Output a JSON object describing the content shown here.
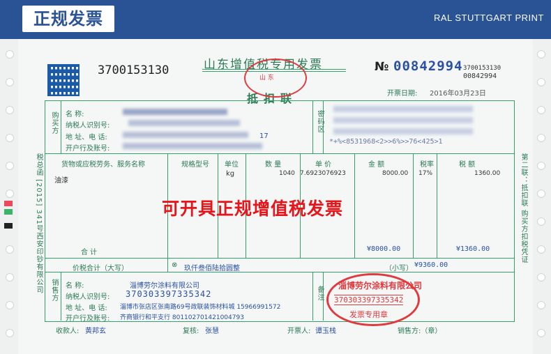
{
  "header": {
    "title": "正规发票",
    "brand": "RAL STUTTGART PRINT"
  },
  "invoice": {
    "code": "3700153130",
    "title": "山东增值税专用发票",
    "copy_label": "抵扣联",
    "number_symbol": "№",
    "number": "00842994",
    "code_small": "3700153130",
    "number_small": "00842994",
    "issue_date_label": "开票日期:",
    "issue_date": "2016年03月23日",
    "side_left": "税总函 [2015] 341号西安印钞有限公司",
    "side_right": "第二联：抵扣联 购买方扣税凭证",
    "buyer": {
      "section": "购买方",
      "name_label": "名      称:",
      "tax_id_label": "纳税人识别号:",
      "address_label": "地 址、电 话:",
      "bank_label": "开户行及账号:",
      "address_tail": "17"
    },
    "cipher": {
      "section": "密码区",
      "line4": "*+%<8531968<2>>6%>>76<425>1"
    },
    "columns": {
      "goods": "货物或应税劳务、服务名称",
      "spec": "规格型号",
      "unit": "单位",
      "qty": "数 量",
      "price": "单 价",
      "amount": "金     额",
      "rate": "税率",
      "tax": "税     额"
    },
    "item": {
      "name": "油漆",
      "unit": "kg",
      "qty": "1040",
      "price": "7.6923076923",
      "amount": "8000.00",
      "rate": "17%",
      "tax": "1360.00"
    },
    "total_label": "合          计",
    "total_amount": "¥8000.00",
    "total_tax": "¥1360.00",
    "grand_label": "价税合计（大写）",
    "grand_words_icon": "⊗",
    "grand_words": "玖仟叁佰陆拾圆整",
    "grand_small_label": "（小写）",
    "grand_small": "¥9360.00",
    "seller": {
      "section": "销售方",
      "name_label": "名      称:",
      "name": "淄博劳尔涂料有限公司",
      "tax_id_label": "纳税人识别号:",
      "tax_id": "370303397335342",
      "address_label": "地 址、电 话:",
      "address": "淄博市张店区张南路69号政联装饰材料城  15966991572",
      "bank_label": "开户行及账号:",
      "bank": "齐商银行和平支行  801102701421004793"
    },
    "remark_label": "备注",
    "footer": {
      "payee_label": "收款人:",
      "payee": "黄邦玄",
      "checker_label": "复核:",
      "checker": "张慧",
      "drawer_label": "开票人:",
      "drawer": "谭玉栈",
      "seller_label": "销售方:（章）"
    },
    "overlay": "可开具正规增值税发票",
    "stamp_seller": {
      "name": "淄博劳尔涂料有限公司",
      "tax_id": "370303397335342",
      "text": "发票专用章"
    }
  }
}
